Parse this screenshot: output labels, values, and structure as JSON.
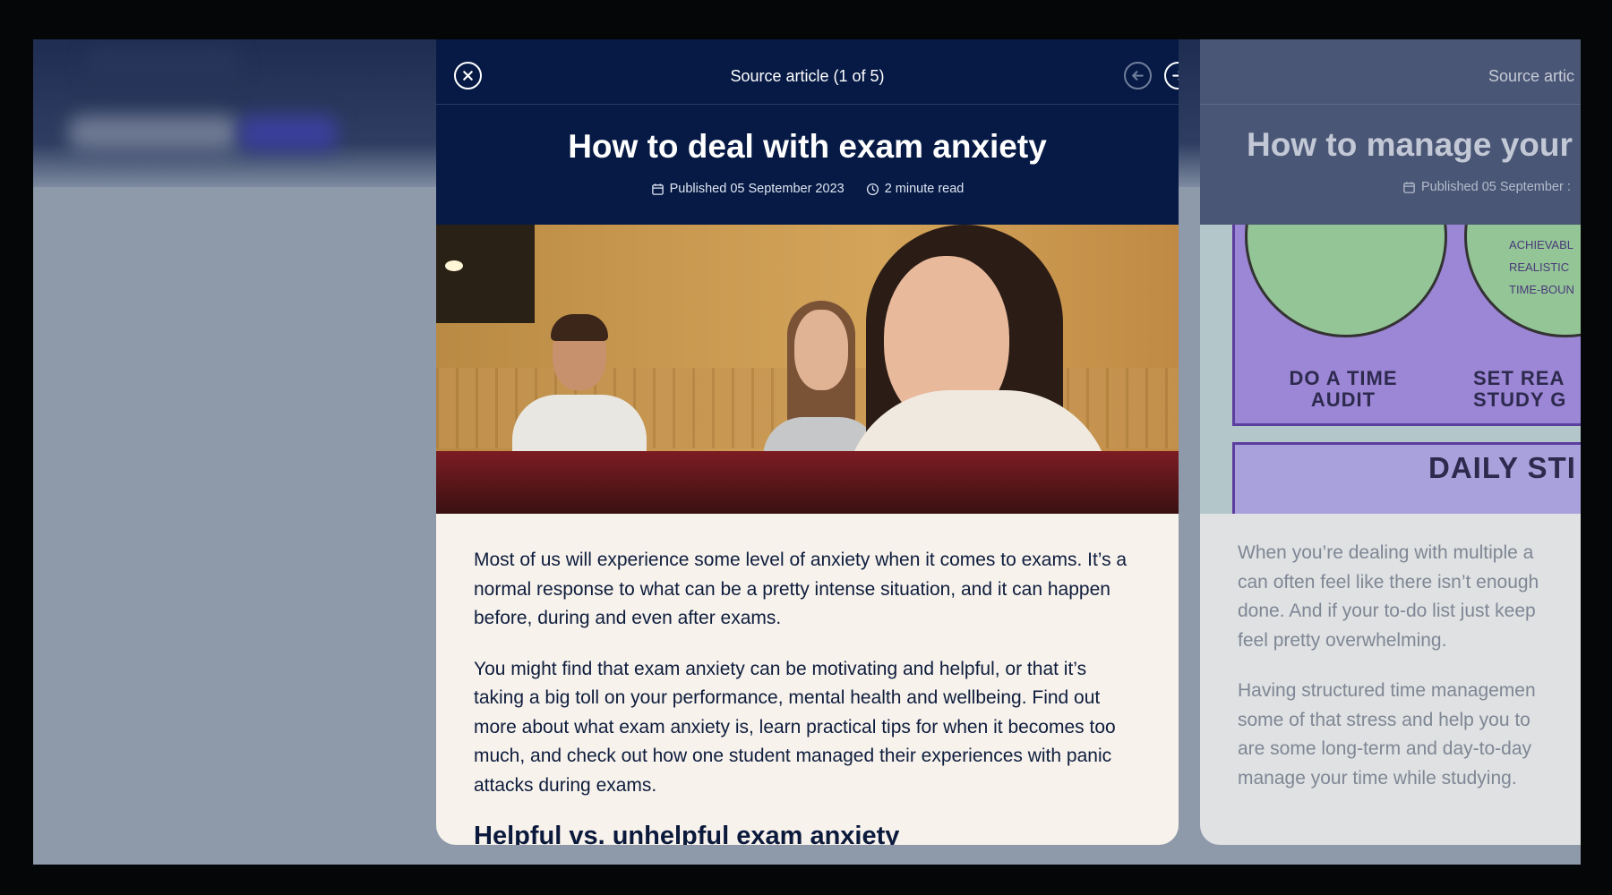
{
  "viewer": {
    "counter": "Source article (1 of 5)",
    "close_icon": "close-icon",
    "prev_icon": "arrow-left-icon",
    "next_icon": "arrow-right-icon"
  },
  "article": {
    "title": "How to deal with exam anxiety",
    "published": "Published 05 September 2023",
    "read_time": "2 minute read",
    "paragraphs": [
      "Most of us will experience some level of anxiety when it comes to exams. It’s a normal response to what can be a pretty intense situation, and it can happen before, during and even after exams.",
      "You might find that exam anxiety can be motivating and helpful, or that it’s taking a big toll on your performance, mental health and wellbeing. Find out more about what exam anxiety is, learn practical tips for when it becomes too much, and check out how one student managed their experiences with panic attacks during exams."
    ],
    "subheading": "Helpful vs. unhelpful exam anxiety"
  },
  "next_article": {
    "counter": "Source artic",
    "title": "How to manage your",
    "published": "Published 05 September :",
    "illustration_labels": [
      "DO A TIME AUDIT",
      "SET REA STUDY G",
      "DAILY STI"
    ],
    "illustration_list": [
      "ACHIEVABL",
      "REALISTIC",
      "TIME-BOUN"
    ],
    "lines": [
      "When you’re dealing with multiple a",
      "can often feel like there isn’t enough",
      "done. And if your to-do list just keep",
      "feel pretty overwhelming.",
      "Having structured time managemen",
      "some of that stress and help you to",
      "are some long-term and day-to-day",
      "manage your time while studying."
    ]
  },
  "colors": {
    "header_navy": "#061a45",
    "card_bg": "#f7f2ec",
    "text_navy": "#0e1d3d"
  }
}
